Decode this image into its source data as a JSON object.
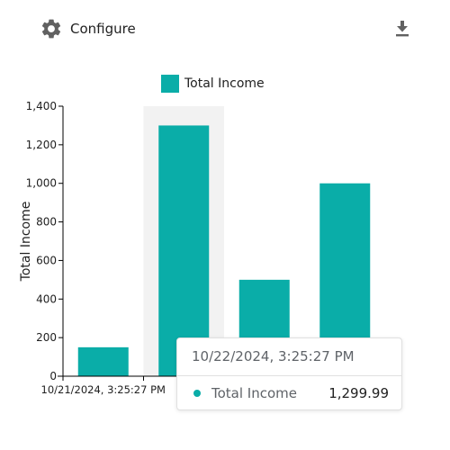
{
  "toolbar": {
    "configure_label": "Configure",
    "configure_icon": "gear-icon",
    "download_icon": "download-icon"
  },
  "colors": {
    "bar": "#0aada8",
    "highlight_band": "#f2f2f2",
    "axis": "#000000",
    "icon": "#616161"
  },
  "legend": {
    "label": "Total Income"
  },
  "chart_data": {
    "type": "bar",
    "categories": [
      "10/21/2024, 3:25:27 PM",
      "10/22/2024, 3:25:27 PM",
      "",
      ""
    ],
    "x_tick_labels_visible": [
      "10/21/2024, 3:25:27 PM"
    ],
    "series": [
      {
        "name": "Total Income",
        "values": [
          150,
          1299.99,
          500,
          1000
        ]
      }
    ],
    "ylabel": "Total Income",
    "ylim": [
      0,
      1400
    ],
    "yticks": [
      0,
      200,
      400,
      600,
      800,
      1000,
      1200,
      1400
    ],
    "ytick_labels": [
      "0",
      "200",
      "400",
      "600",
      "800",
      "1,000",
      "1,200",
      "1,400"
    ],
    "highlighted_index": 1,
    "grid": false,
    "legend_position": "top-center"
  },
  "tooltip": {
    "title": "10/22/2024, 3:25:27 PM",
    "series_name": "Total Income",
    "value": "1,299.99"
  }
}
